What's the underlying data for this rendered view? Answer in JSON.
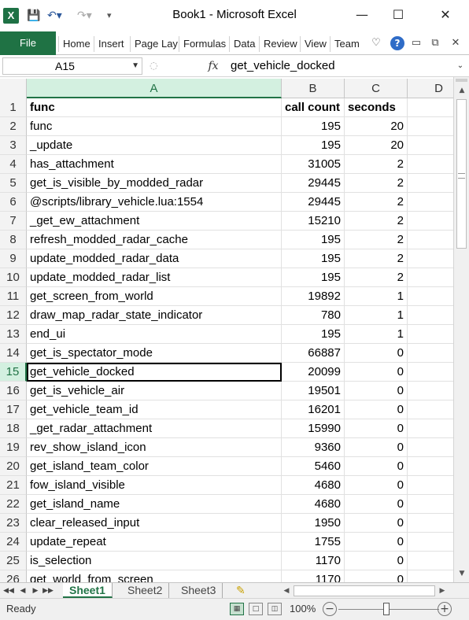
{
  "app": {
    "title": "Book1  -  Microsoft Excel",
    "logo_letter": "X",
    "quick_access": [
      "save-icon",
      "undo-icon",
      "redo-icon",
      "customize-icon"
    ],
    "window_controls": [
      "minimize",
      "maximize",
      "close"
    ]
  },
  "ribbon": {
    "file_label": "File",
    "tabs": [
      "Home",
      "Insert",
      "Page Lay",
      "Formulas",
      "Data",
      "Review",
      "View",
      "Team"
    ],
    "colors": {
      "file_tab": "#1f7244",
      "accent": "#217346"
    }
  },
  "formula_bar": {
    "name_box": "A15",
    "fx_label": "fx",
    "formula": "get_vehicle_docked"
  },
  "grid": {
    "columns": [
      "A",
      "B",
      "C",
      "D"
    ],
    "active_column": "A",
    "active_row": "15",
    "rows": [
      {
        "n": "1",
        "a": "func",
        "b": "call count",
        "c": "seconds"
      },
      {
        "n": "2",
        "a": "func",
        "b": "195",
        "c": "20"
      },
      {
        "n": "3",
        "a": "_update",
        "b": "195",
        "c": "20"
      },
      {
        "n": "4",
        "a": "has_attachment",
        "b": "31005",
        "c": "2"
      },
      {
        "n": "5",
        "a": "get_is_visible_by_modded_radar",
        "b": "29445",
        "c": "2"
      },
      {
        "n": "6",
        "a": "@scripts/library_vehicle.lua:1554",
        "b": "29445",
        "c": "2"
      },
      {
        "n": "7",
        "a": "_get_ew_attachment",
        "b": "15210",
        "c": "2"
      },
      {
        "n": "8",
        "a": "refresh_modded_radar_cache",
        "b": "195",
        "c": "2"
      },
      {
        "n": "9",
        "a": "update_modded_radar_data",
        "b": "195",
        "c": "2"
      },
      {
        "n": "10",
        "a": "update_modded_radar_list",
        "b": "195",
        "c": "2"
      },
      {
        "n": "11",
        "a": "get_screen_from_world",
        "b": "19892",
        "c": "1"
      },
      {
        "n": "12",
        "a": "draw_map_radar_state_indicator",
        "b": "780",
        "c": "1"
      },
      {
        "n": "13",
        "a": "end_ui",
        "b": "195",
        "c": "1"
      },
      {
        "n": "14",
        "a": "get_is_spectator_mode",
        "b": "66887",
        "c": "0"
      },
      {
        "n": "15",
        "a": "get_vehicle_docked",
        "b": "20099",
        "c": "0"
      },
      {
        "n": "16",
        "a": "get_is_vehicle_air",
        "b": "19501",
        "c": "0"
      },
      {
        "n": "17",
        "a": "get_vehicle_team_id",
        "b": "16201",
        "c": "0"
      },
      {
        "n": "18",
        "a": "_get_radar_attachment",
        "b": "15990",
        "c": "0"
      },
      {
        "n": "19",
        "a": "rev_show_island_icon",
        "b": "9360",
        "c": "0"
      },
      {
        "n": "20",
        "a": "get_island_team_color",
        "b": "5460",
        "c": "0"
      },
      {
        "n": "21",
        "a": "fow_island_visible",
        "b": "4680",
        "c": "0"
      },
      {
        "n": "22",
        "a": "get_island_name",
        "b": "4680",
        "c": "0"
      },
      {
        "n": "23",
        "a": "clear_released_input",
        "b": "1950",
        "c": "0"
      },
      {
        "n": "24",
        "a": "update_repeat",
        "b": "1755",
        "c": "0"
      },
      {
        "n": "25",
        "a": "is_selection",
        "b": "1170",
        "c": "0"
      },
      {
        "n": "26",
        "a": "get_world_from_screen",
        "b": "1170",
        "c": "0"
      }
    ]
  },
  "sheets": {
    "tabs": [
      "Sheet1",
      "Sheet2",
      "Sheet3"
    ],
    "active": "Sheet1"
  },
  "status": {
    "ready": "Ready",
    "zoom": "100%",
    "zoom_minus": "−",
    "zoom_plus": "+"
  }
}
